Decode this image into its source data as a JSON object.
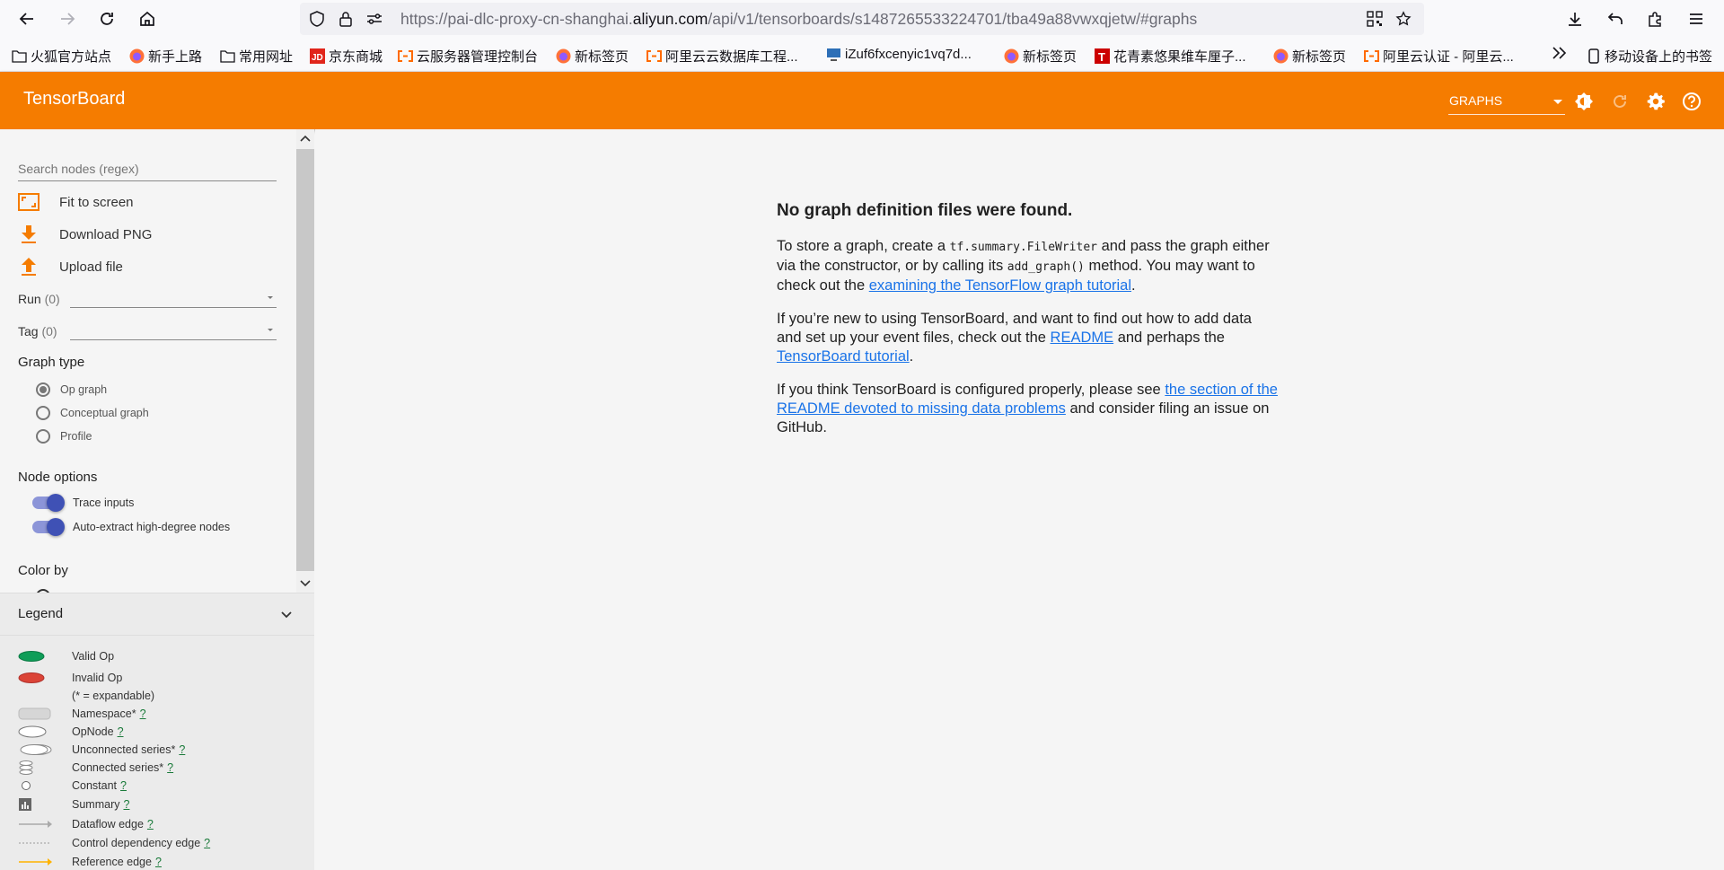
{
  "browser": {
    "url_prefix": "https://pai-dlc-proxy-cn-shanghai.",
    "url_domain": "aliyun.com",
    "url_suffix": "/api/v1/tensorboards/s1487265533224701/tba49a88vwxqjetw/#graphs",
    "bookmarks": [
      {
        "label": "火狐官方站点",
        "icon": "folder-icon"
      },
      {
        "label": "新手上路",
        "icon": "firefox-icon"
      },
      {
        "label": "常用网址",
        "icon": "folder-icon"
      },
      {
        "label": "京东商城",
        "icon": "jd-icon"
      },
      {
        "label": "云服务器管理控制台",
        "icon": "aliyun-icon"
      },
      {
        "label": "新标签页",
        "icon": "firefox-icon"
      },
      {
        "label": "阿里云云数据库工程...",
        "icon": "aliyun-icon"
      },
      {
        "label": "iZuf6fxcenyic1vq7d...",
        "icon": "monitor-icon"
      },
      {
        "label": "新标签页",
        "icon": "firefox-icon"
      },
      {
        "label": "花青素悠果维车厘子...",
        "icon": "tmall-icon"
      },
      {
        "label": "新标签页",
        "icon": "firefox-icon"
      },
      {
        "label": "阿里云认证 - 阿里云...",
        "icon": "aliyun-icon"
      }
    ],
    "mobile_bookmarks": "移动设备上的书签"
  },
  "header": {
    "title": "TensorBoard",
    "dashboard_select": "GRAPHS",
    "accent_color": "#f57c00"
  },
  "sidebar": {
    "search_placeholder": "Search nodes (regex)",
    "actions": {
      "fit": "Fit to screen",
      "download": "Download PNG",
      "upload": "Upload file"
    },
    "run_label": "Run",
    "run_count": "(0)",
    "tag_label": "Tag",
    "tag_count": "(0)",
    "graph_type_title": "Graph type",
    "graph_types": [
      "Op graph",
      "Conceptual graph",
      "Profile"
    ],
    "node_options_title": "Node options",
    "toggles": [
      "Trace inputs",
      "Auto-extract high-degree nodes"
    ],
    "color_by_title": "Color by"
  },
  "legend": {
    "title": "Legend",
    "items": [
      {
        "label": "Valid Op",
        "help": ""
      },
      {
        "label": "Invalid Op",
        "help": ""
      },
      {
        "label": "(* = expandable)",
        "help": ""
      },
      {
        "label": "Namespace*",
        "help": "?"
      },
      {
        "label": "OpNode",
        "help": "?"
      },
      {
        "label": "Unconnected series*",
        "help": "?"
      },
      {
        "label": "Connected series*",
        "help": "?"
      },
      {
        "label": "Constant",
        "help": "?"
      },
      {
        "label": "Summary",
        "help": "?"
      },
      {
        "label": "Dataflow edge",
        "help": "?"
      },
      {
        "label": "Control dependency edge",
        "help": "?"
      },
      {
        "label": "Reference edge",
        "help": "?"
      }
    ]
  },
  "main": {
    "heading": "No graph definition files were found.",
    "p1_a": "To store a graph, create a ",
    "p1_code1": "tf.summary.FileWriter",
    "p1_b": " and pass the graph either via the constructor, or by calling its ",
    "p1_code2": "add_graph()",
    "p1_c": " method. You may want to check out the ",
    "p1_link": "examining the TensorFlow graph tutorial",
    "p1_d": ".",
    "p2_a": "If you’re new to using TensorBoard, and want to find out how to add data and set up your event files, check out the ",
    "p2_link1": "README",
    "p2_b": " and perhaps the ",
    "p2_link2": "TensorBoard tutorial",
    "p2_c": ".",
    "p3_a": "If you think TensorBoard is configured properly, please see ",
    "p3_link": "the section of the README devoted to missing data problems",
    "p3_b": " and consider filing an issue on GitHub."
  }
}
